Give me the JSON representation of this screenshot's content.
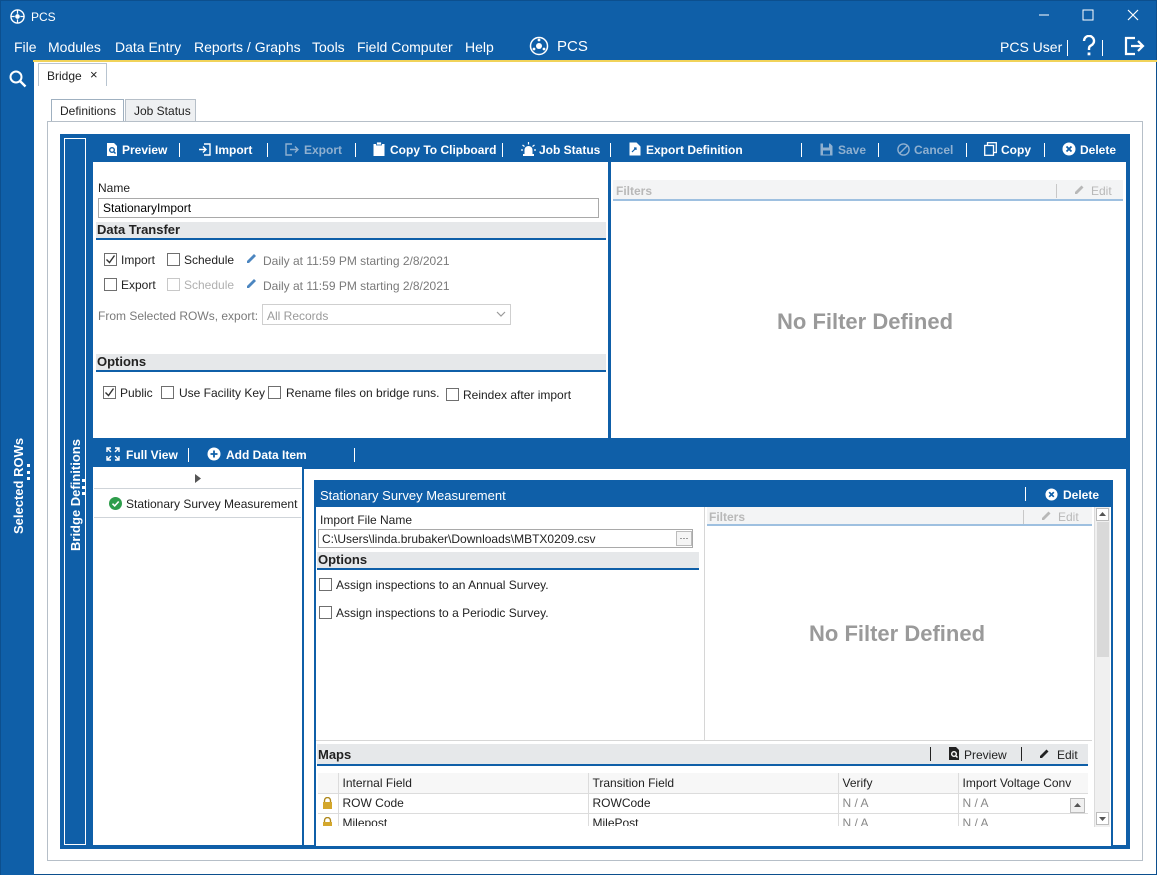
{
  "window": {
    "title": "PCS",
    "brand": "PCS",
    "user": "PCS User"
  },
  "menu": [
    "File",
    "Modules",
    "Data Entry",
    "Reports / Graphs",
    "Tools",
    "Field Computer",
    "Help"
  ],
  "side": {
    "selected_rows": "Selected ROWs",
    "bridge_definitions": "Bridge Definitions"
  },
  "doc_tab": {
    "label": "Bridge",
    "close": "×"
  },
  "sub_tabs": [
    "Definitions",
    "Job Status"
  ],
  "toolbar": {
    "preview": "Preview",
    "import": "Import",
    "export": "Export",
    "copy_clipboard": "Copy To Clipboard",
    "job_status": "Job Status",
    "export_definition": "Export Definition",
    "save": "Save",
    "cancel": "Cancel",
    "copy": "Copy",
    "delete": "Delete"
  },
  "definition": {
    "name_label": "Name",
    "name_value": "StationaryImport",
    "data_transfer": "Data Transfer",
    "import_label": "Import",
    "export_label": "Export",
    "schedule_label": "Schedule",
    "import_schedule": "Daily at 11:59 PM starting 2/8/2021",
    "export_schedule": "Daily at 11:59 PM starting 2/8/2021",
    "from_selected_label": "From Selected ROWs, export:",
    "from_selected_value": "All Records",
    "options": "Options",
    "public": "Public",
    "use_facility_key": "Use Facility Key",
    "rename_files": "Rename files on bridge runs.",
    "reindex": "Reindex after import"
  },
  "filters": {
    "label": "Filters",
    "edit": "Edit",
    "empty": "No Filter Defined"
  },
  "lower_toolbar": {
    "full_view": "Full View",
    "add_data_item": "Add Data Item"
  },
  "data_items": [
    {
      "label": "Stationary Survey Measurement",
      "status": "ok"
    }
  ],
  "item_detail": {
    "title": "Stationary Survey Measurement",
    "delete": "Delete",
    "import_file_label": "Import File Name",
    "import_file_value": "C:\\Users\\linda.brubaker\\Downloads\\MBTX0209.csv",
    "browse": "···",
    "options": "Options",
    "opt_annual": "Assign inspections to an Annual Survey.",
    "opt_periodic": "Assign inspections to a Periodic Survey.",
    "filters": "Filters",
    "filters_edit": "Edit",
    "filters_empty": "No Filter Defined"
  },
  "maps": {
    "label": "Maps",
    "preview": "Preview",
    "edit": "Edit",
    "columns": [
      "Internal Field",
      "Transition Field",
      "Verify",
      "Import Voltage Conv"
    ],
    "rows": [
      {
        "internal": "ROW Code",
        "transition": "ROWCode",
        "verify": "N / A",
        "voltage": "N / A"
      },
      {
        "internal": "Milepost",
        "transition": "MilePost",
        "verify": "N / A",
        "voltage": "N / A"
      }
    ]
  },
  "colors": {
    "accent": "#0f5fa8",
    "highlight": "#f1d35a",
    "ok": "#2e9d4b"
  }
}
